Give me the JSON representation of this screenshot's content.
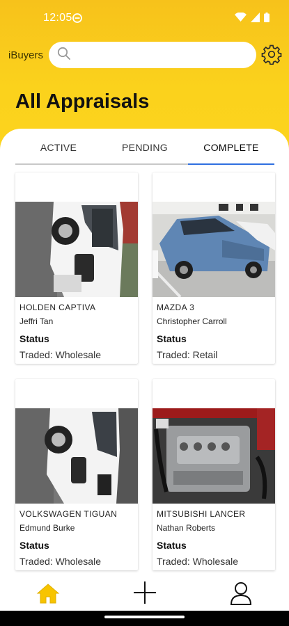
{
  "status_bar": {
    "time": "12:05"
  },
  "header": {
    "brand": "iBuyers",
    "search_placeholder": "",
    "search_icon": "search-icon",
    "settings_icon": "gear-icon"
  },
  "page_title": "All Appraisals",
  "tabs": [
    {
      "label": "ACTIVE",
      "active": false
    },
    {
      "label": "PENDING",
      "active": false
    },
    {
      "label": "COMPLETE",
      "active": true
    }
  ],
  "cards": [
    {
      "model": "HOLDEN CAPTIVA",
      "owner": "Jeffri Tan",
      "status_label": "Status",
      "traded": "Traded: Wholesale"
    },
    {
      "model": "MAZDA 3",
      "owner": "Christopher Carroll",
      "status_label": "Status",
      "traded": "Traded: Retail"
    },
    {
      "model": "VOLKSWAGEN TIGUAN",
      "owner": "Edmund Burke",
      "status_label": "Status",
      "traded": "Traded: Wholesale"
    },
    {
      "model": "MITSUBISHI LANCER",
      "owner": "Nathan Roberts",
      "status_label": "Status",
      "traded": "Traded: Wholesale"
    }
  ],
  "bottom_nav": [
    {
      "icon": "home-icon",
      "active": true
    },
    {
      "icon": "plus-icon",
      "active": false
    },
    {
      "icon": "user-icon",
      "active": false
    }
  ],
  "colors": {
    "brand_yellow": "#FBD21C",
    "tab_underline": "#2F6FE0",
    "home_active": "#F7C400"
  }
}
